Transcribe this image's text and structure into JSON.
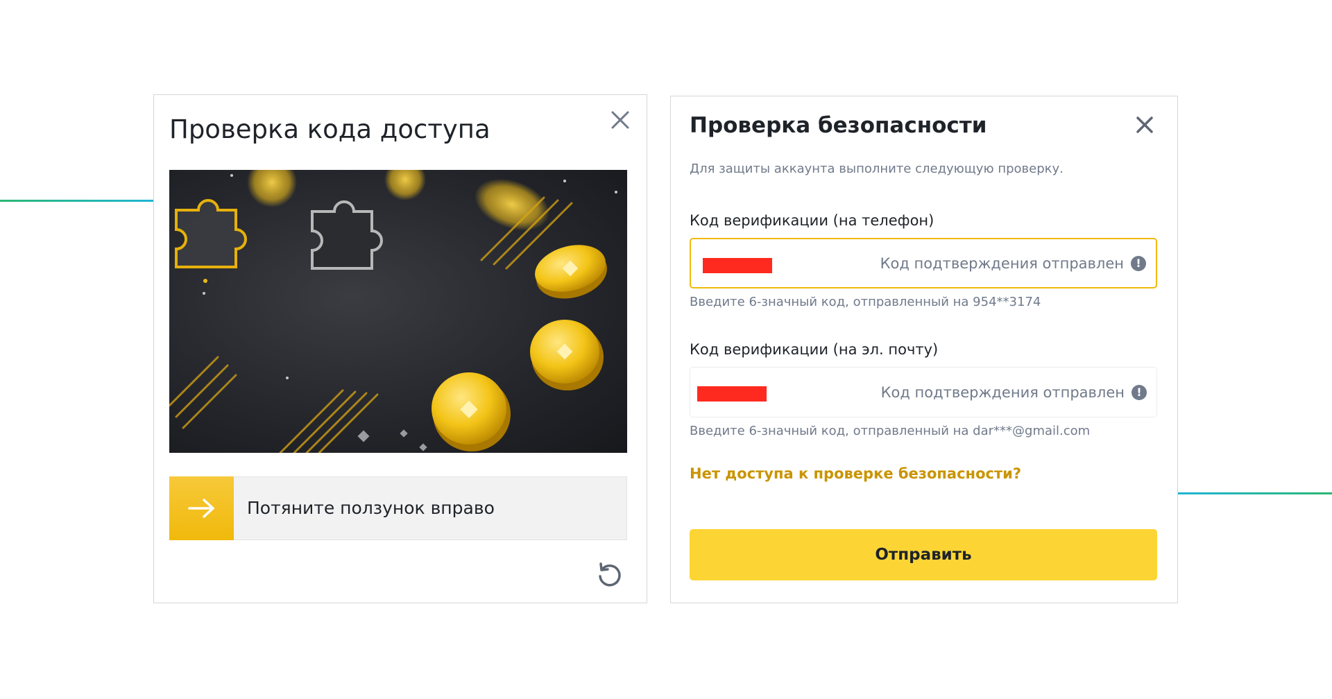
{
  "captcha_dialog": {
    "title": "Проверка кода доступа",
    "close_icon": "close-icon",
    "slider_label": "Потяните ползунок вправо",
    "slider_icon": "arrow-right-icon",
    "refresh_icon": "refresh-icon",
    "accent_color": "#F0B90B"
  },
  "security_dialog": {
    "title": "Проверка безопасности",
    "close_icon": "close-icon",
    "subtitle": "Для защиты аккаунта выполните следующую проверку.",
    "phone_field": {
      "label": "Код верификации (на телефон)",
      "status": "Код подтверждения отправлен",
      "status_icon": "!",
      "hint": "Введите 6-значный код, отправленный на 954**3174"
    },
    "email_field": {
      "label": "Код верификации (на эл. почту)",
      "status": "Код подтверждения отправлен",
      "status_icon": "!",
      "hint": "Введите 6-значный код, отправленный на dar***@gmail.com"
    },
    "no_access_link": "Нет доступа к проверке безопасности?",
    "submit_label": "Отправить",
    "accent_color": "#FCD535",
    "link_color": "#C99400"
  }
}
